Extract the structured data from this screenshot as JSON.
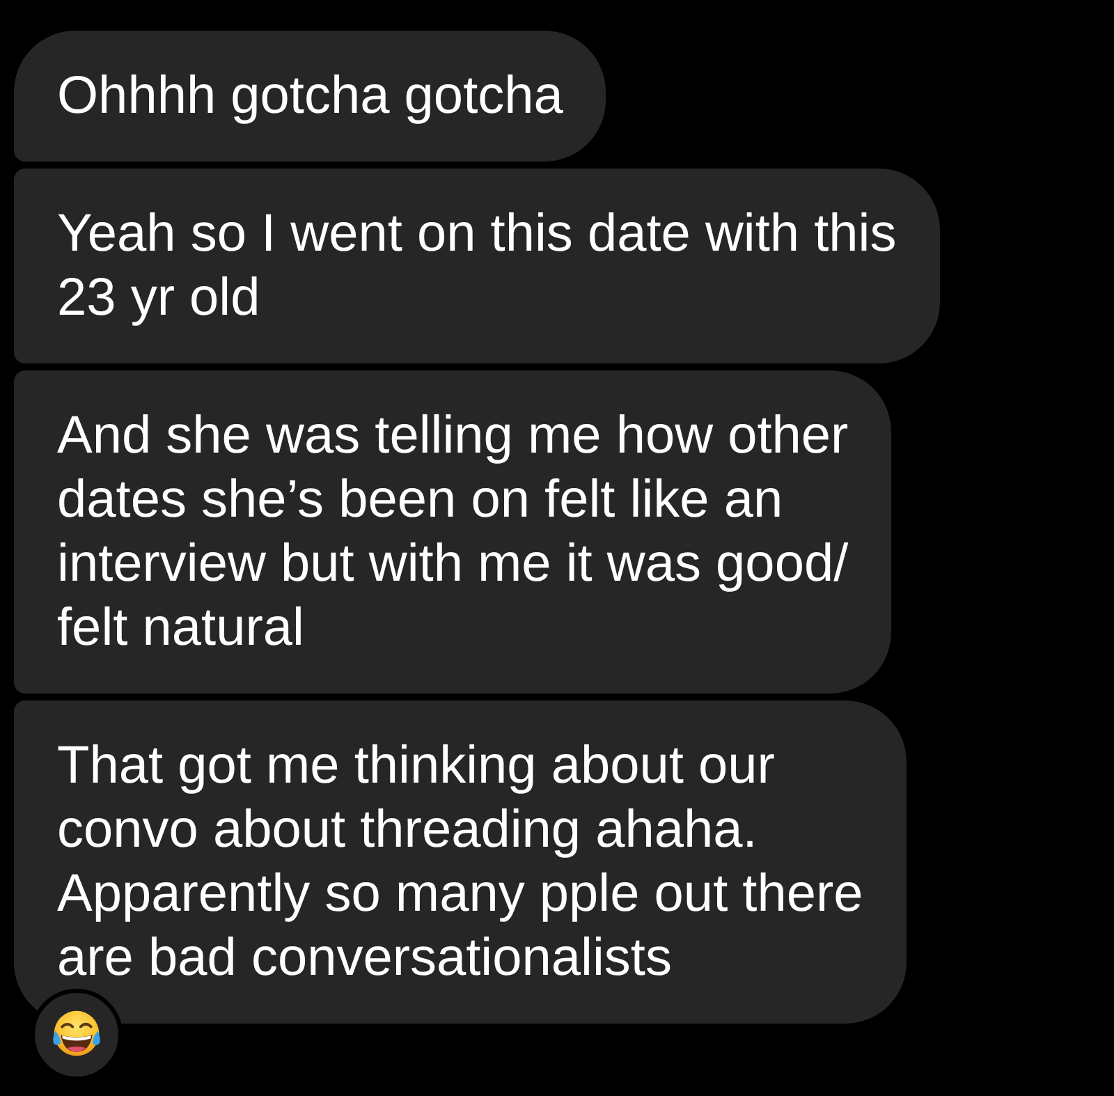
{
  "messages": [
    {
      "text": "Ohhhh gotcha gotcha",
      "reacted": false
    },
    {
      "text": "Yeah so I went on this date with this\n23 yr old",
      "reacted": false
    },
    {
      "text": "And she was telling me how other\ndates she’s been on felt like an\ninterview but with me it was good/\nfelt natural",
      "reacted": false
    },
    {
      "text": "That got me thinking about our\nconvo about threading ahaha.\nApparently so many pple out there\nare bad conversationalists",
      "reacted": true
    }
  ]
}
